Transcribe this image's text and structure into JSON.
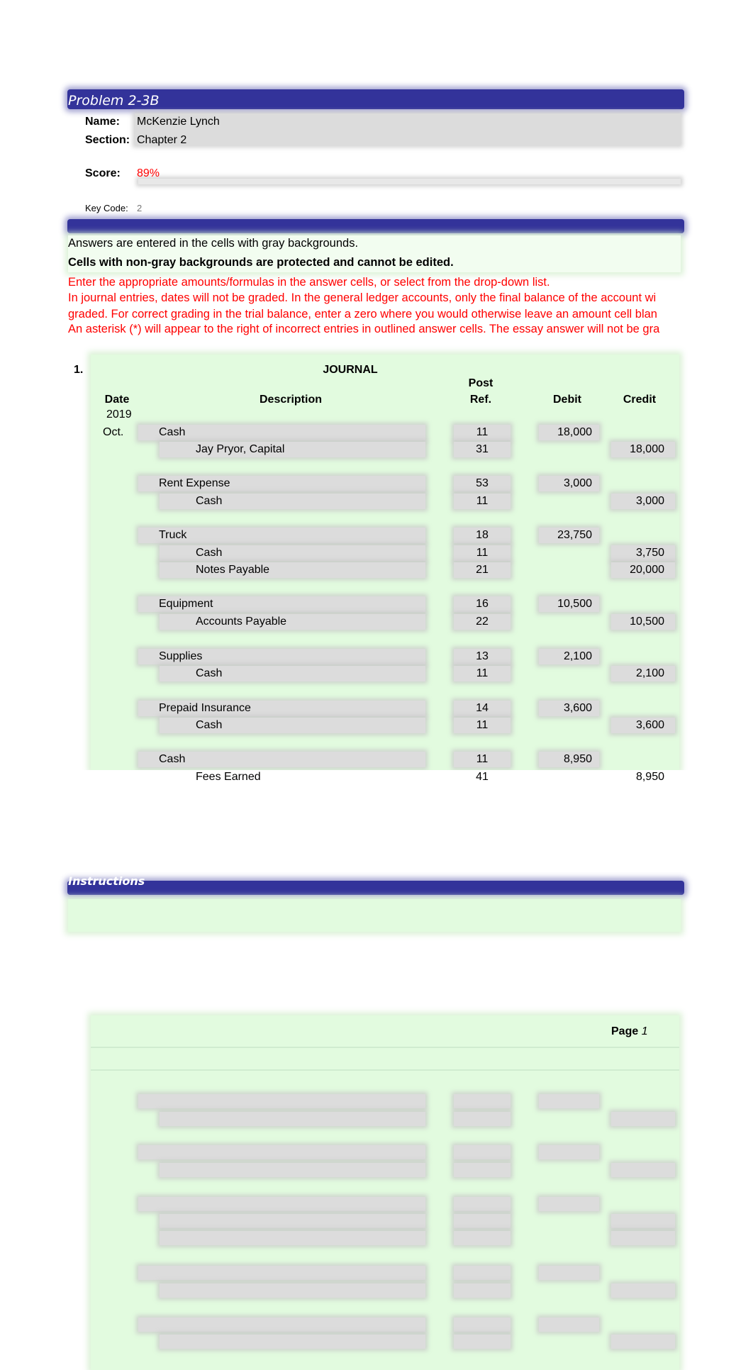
{
  "header": {
    "title": "Problem 2-3B",
    "name_label": "Name:",
    "name_value": "McKenzie Lynch",
    "section_label": "Section:",
    "section_value": "Chapter 2",
    "score_label": "Score:",
    "score_value": "89%",
    "key_code_label": "Key Code:",
    "key_code_value": "2"
  },
  "instructions": {
    "line1": "Answers are entered in the cells with gray backgrounds.",
    "line2": "Cells with non-gray backgrounds are protected and cannot be edited.",
    "line3": "Enter the appropriate amounts/formulas in the answer cells, or select from the drop-down list.",
    "line4": "In journal entries, dates will not be graded. In the general ledger accounts, only the final balance of the account wi",
    "line5": "graded. For correct grading in the trial balance, enter a zero where you would otherwise leave an amount cell blan",
    "line6": "An asterisk (*) will appear to the right of incorrect entries in outlined answer cells. The essay answer will not be gra"
  },
  "journal": {
    "number": "1.",
    "title": "JOURNAL",
    "col_date": "Date",
    "col_description": "Description",
    "col_post_top": "Post",
    "col_post_bottom": "Ref.",
    "col_debit": "Debit",
    "col_credit": "Credit",
    "year": "2019",
    "month": "Oct.",
    "rows": [
      {
        "desc": "Cash",
        "indent": false,
        "ref": "11",
        "debit": "18,000",
        "credit": ""
      },
      {
        "desc": "Jay Pryor, Capital",
        "indent": true,
        "ref": "31",
        "debit": "",
        "credit": "18,000"
      },
      {
        "desc": "Rent Expense",
        "indent": false,
        "ref": "53",
        "debit": "3,000",
        "credit": ""
      },
      {
        "desc": "Cash",
        "indent": true,
        "ref": "11",
        "debit": "",
        "credit": "3,000"
      },
      {
        "desc": "Truck",
        "indent": false,
        "ref": "18",
        "debit": "23,750",
        "credit": ""
      },
      {
        "desc": "Cash",
        "indent": true,
        "ref": "11",
        "debit": "",
        "credit": "3,750"
      },
      {
        "desc": "Notes Payable",
        "indent": true,
        "ref": "21",
        "debit": "",
        "credit": "20,000"
      },
      {
        "desc": "Equipment",
        "indent": false,
        "ref": "16",
        "debit": "10,500",
        "credit": ""
      },
      {
        "desc": "Accounts Payable",
        "indent": true,
        "ref": "22",
        "debit": "",
        "credit": "10,500"
      },
      {
        "desc": "Supplies",
        "indent": false,
        "ref": "13",
        "debit": "2,100",
        "credit": ""
      },
      {
        "desc": "Cash",
        "indent": true,
        "ref": "11",
        "debit": "",
        "credit": "2,100"
      },
      {
        "desc": "Prepaid Insurance",
        "indent": false,
        "ref": "14",
        "debit": "3,600",
        "credit": ""
      },
      {
        "desc": "Cash",
        "indent": true,
        "ref": "11",
        "debit": "",
        "credit": "3,600"
      },
      {
        "desc": "Cash",
        "indent": false,
        "ref": "11",
        "debit": "8,950",
        "credit": ""
      },
      {
        "desc": "Fees Earned",
        "indent": true,
        "ref": "41",
        "debit": "",
        "credit": "8,950"
      }
    ]
  },
  "instructions_section": {
    "title": "Instructions"
  },
  "page2": {
    "page_label": "Page",
    "page_number": "1"
  },
  "colors": {
    "header_bar": "#33339a",
    "answer_cell": "#dcdcdc",
    "protected_cell": "#e2fbdf",
    "warning_text": "#ff0000"
  }
}
